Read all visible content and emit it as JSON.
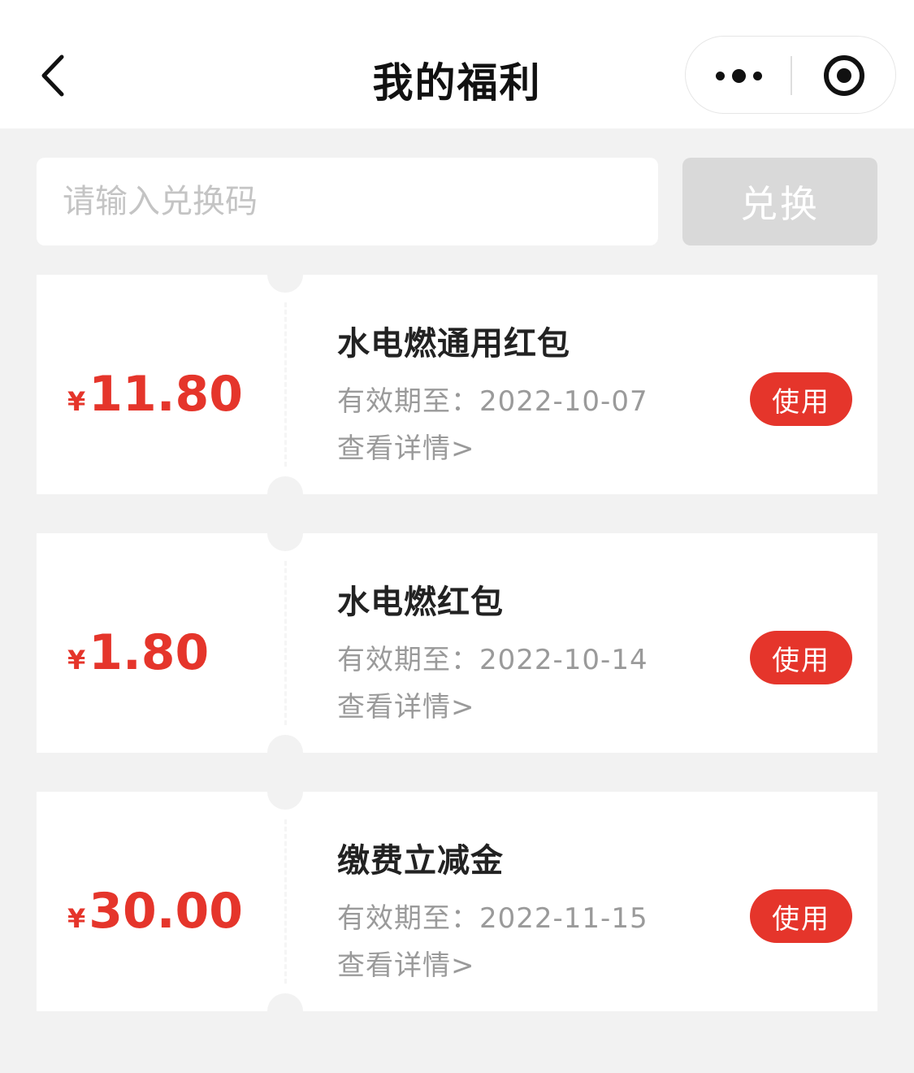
{
  "header": {
    "title": "我的福利",
    "back_icon": "chevron-left-icon",
    "more_icon": "more-dots-icon",
    "close_icon": "target-close-icon"
  },
  "redeem": {
    "placeholder": "请输入兑换码",
    "value": "",
    "button_label": "兑换"
  },
  "colors": {
    "accent": "#e5352b",
    "background": "#f2f2f2",
    "card": "#ffffff",
    "disabled_button": "#d9d9d9",
    "muted_text": "#9a9a9a"
  },
  "coupons": [
    {
      "currency": "¥",
      "amount": "11.80",
      "title": "水电燃通用红包",
      "expiry": "有效期至：2022-10-07",
      "details_link": "查看详情>",
      "use_label": "使用"
    },
    {
      "currency": "¥",
      "amount": "1.80",
      "title": "水电燃红包",
      "expiry": "有效期至：2022-10-14",
      "details_link": "查看详情>",
      "use_label": "使用"
    },
    {
      "currency": "¥",
      "amount": "30.00",
      "title": "缴费立减金",
      "expiry": "有效期至：2022-11-15",
      "details_link": "查看详情>",
      "use_label": "使用"
    }
  ]
}
